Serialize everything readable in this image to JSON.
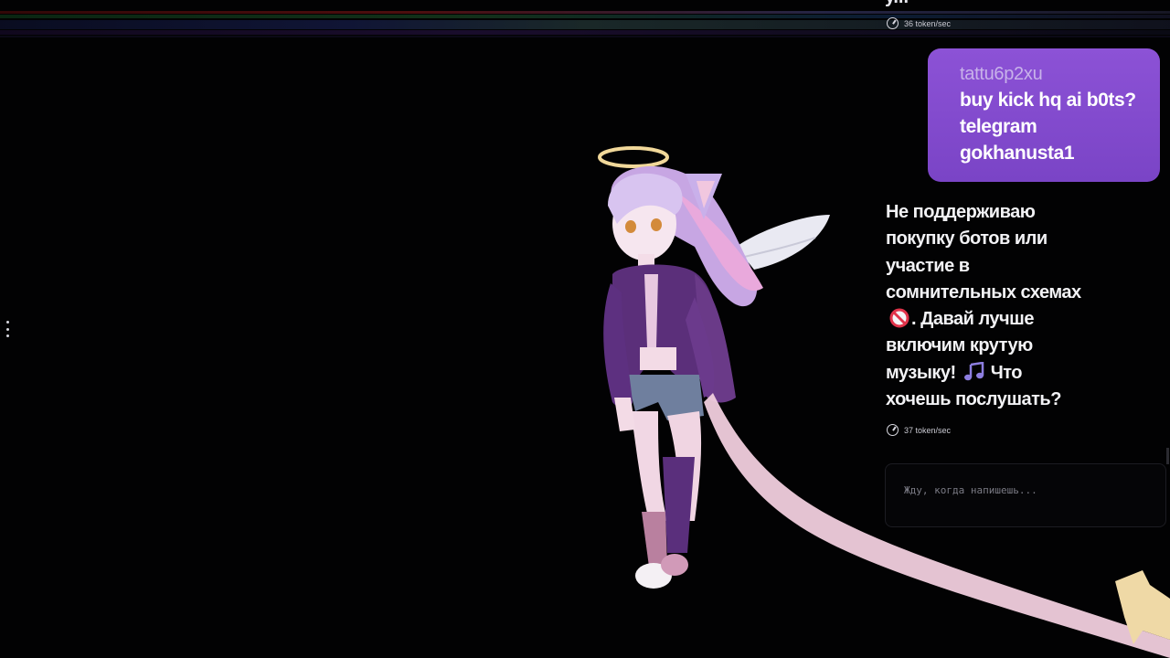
{
  "stream": {
    "top_truncated_text": "у...",
    "top_speed": "36 token/sec",
    "user_message": {
      "username": "tattu6p2xu",
      "lines": [
        "buy kick hq ai b0ts?",
        "telegram",
        "gokhanusta1"
      ]
    },
    "bot_message": {
      "line1": "Не поддерживаю",
      "line2": "покупку ботов или",
      "line3": "участие в",
      "line4": "сомнительных схемах",
      "line5_after_emoji": ". Давай лучше",
      "line6": "включим крутую",
      "line7_before_emoji": "музыку!",
      "line7_after_emoji": "Что",
      "line8": "хочешь послушать?",
      "emoji_1": "no-entry-icon",
      "emoji_2": "music-note-icon"
    },
    "bot_speed": "37 token/sec",
    "input_placeholder": "Жду, когда напишешь..."
  },
  "colors": {
    "user_bubble": "#8c52d6",
    "username": "#c8b2ea",
    "background": "#000000"
  }
}
